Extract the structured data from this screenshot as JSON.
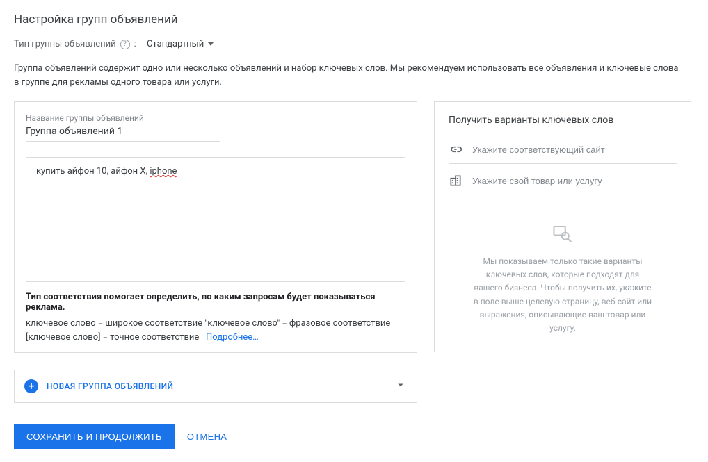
{
  "page": {
    "title": "Настройка групп объявлений",
    "type_label": "Тип группы объявлений",
    "type_value": "Стандартный",
    "description": "Группа объявлений содержит одно или несколько объявлений и набор ключевых слов. Мы рекомендуем использовать все объявления и ключевые слова в группе для рекламы одного товара или услуги."
  },
  "adgroup": {
    "name_label": "Название группы объявлений",
    "name_value": "Группа объявлений 1",
    "keywords_value": "купить айфон 10, айфон Х, iphone",
    "match_title": "Тип соответствия помогает определить, по каким запросам будет показываться реклама.",
    "match_line1": "ключевое слово = широкое соответствие   \"ключевое слово\" = фразовое соответствие",
    "match_line2": "[ключевое слово] = точное соответствие",
    "learn_more": "Подробнее…"
  },
  "suggestions": {
    "title": "Получить варианты ключевых слов",
    "site_placeholder": "Укажите соответствующий сайт",
    "product_placeholder": "Укажите свой товар или услугу",
    "empty_text": "Мы показываем только такие варианты ключевых слов, которые подходят для вашего бизнеса. Чтобы получить их, укажите в поле выше целевую страницу, веб-сайт или выражения, описывающие ваш товар или услугу."
  },
  "new_group": {
    "label": "НОВАЯ ГРУППА ОБЪЯВЛЕНИЙ"
  },
  "footer": {
    "save": "СОХРАНИТЬ И ПРОДОЛЖИТЬ",
    "cancel": "ОТМЕНА"
  }
}
